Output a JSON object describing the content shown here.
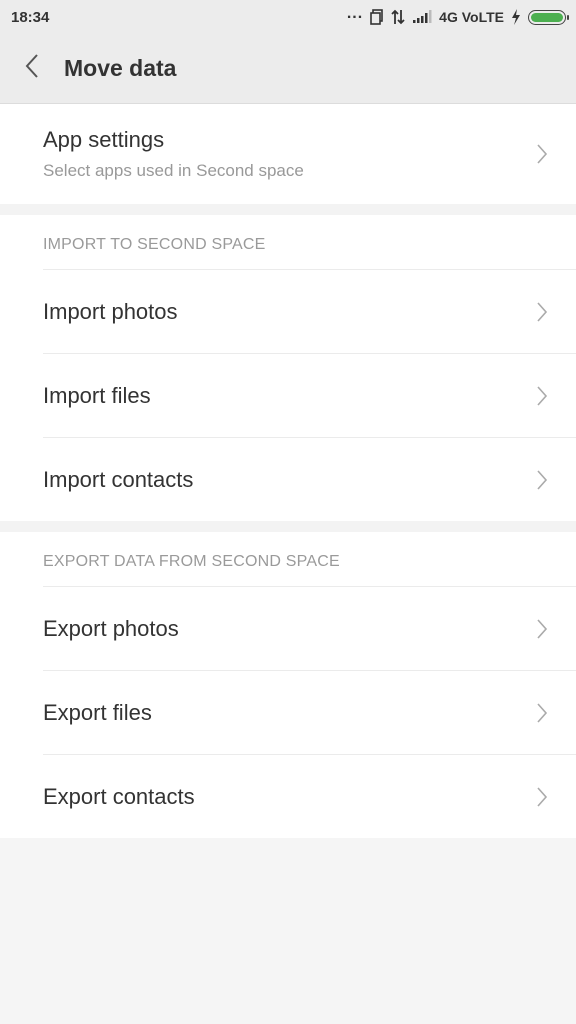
{
  "status_bar": {
    "time": "18:34",
    "dots": "...",
    "network": "4G VoLTE",
    "battery_level": 1.0,
    "battery_color": "#4caf50",
    "icons": [
      "sim-icon",
      "data-arrows-icon",
      "signal-icon",
      "charging-icon",
      "battery-icon"
    ]
  },
  "app_bar": {
    "title": "Move data",
    "back_icon": "back-arrow-icon"
  },
  "app_settings": {
    "title": "App settings",
    "subtitle": "Select apps used in Second space"
  },
  "import_section": {
    "header": "IMPORT TO SECOND SPACE",
    "items": [
      {
        "label": "Import photos"
      },
      {
        "label": "Import files"
      },
      {
        "label": "Import contacts"
      }
    ]
  },
  "export_section": {
    "header": "EXPORT DATA FROM SECOND SPACE",
    "items": [
      {
        "label": "Export photos"
      },
      {
        "label": "Export files"
      },
      {
        "label": "Export contacts"
      }
    ]
  }
}
